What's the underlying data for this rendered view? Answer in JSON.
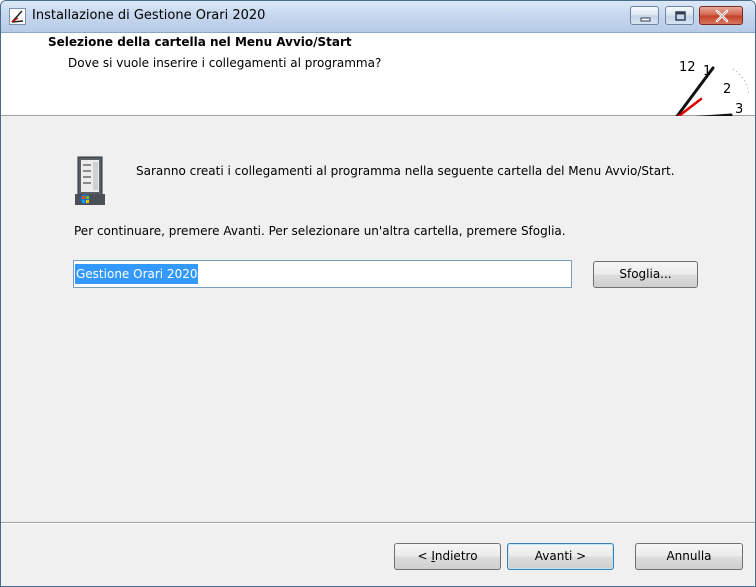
{
  "window": {
    "title": "Installazione di Gestione Orari 2020"
  },
  "header": {
    "title": "Selezione della cartella nel Menu Avvio/Start",
    "subtitle": "Dove si vuole inserire i collegamenti al programma?",
    "clock_numbers": [
      "12",
      "1",
      "2",
      "3"
    ]
  },
  "content": {
    "info_text": "Saranno creati i collegamenti al programma nella seguente cartella del Menu Avvio/Start.",
    "continue_text": "Per continuare, premere Avanti. Per selezionare un'altra cartella, premere Sfoglia.",
    "folder_value": "Gestione Orari 2020",
    "browse_label": "Sfoglia..."
  },
  "footer": {
    "back_prefix": "< ",
    "back_underlined": "I",
    "back_rest": "ndietro",
    "next_label": "Avanti >",
    "cancel_label": "Annulla"
  },
  "colors": {
    "selection": "#3399ff",
    "titlebar": "#c6d8ee",
    "close_button": "#c44127"
  },
  "icons": {
    "window_icon": "clock-hands-icon",
    "minimize": "minimize-icon",
    "maximize": "maximize-icon",
    "close": "close-icon",
    "header_graphic": "clock-icon",
    "folder_graphic": "start-menu-icon"
  }
}
